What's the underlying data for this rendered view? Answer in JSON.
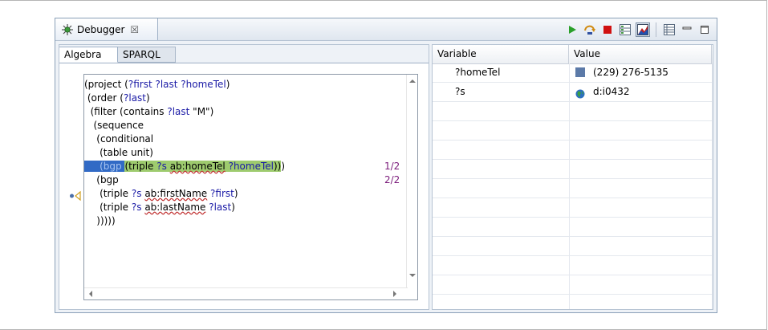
{
  "view": {
    "title": "Debugger",
    "close_glyph": "☒"
  },
  "toolbar": {
    "icons": [
      "resume-icon",
      "step-over-icon",
      "stop-icon",
      "layout-icon",
      "highlight-icon",
      "table-icon",
      "minimize-icon",
      "maximize-icon"
    ],
    "colors": {
      "resume": "#2aa02a",
      "stop": "#d01010",
      "step": "#d08a10"
    }
  },
  "tabs": [
    {
      "label": "Algebra",
      "active": true
    },
    {
      "label": "SPARQL",
      "active": false
    }
  ],
  "code": {
    "lines": [
      {
        "parts": [
          {
            "t": "(project ("
          },
          {
            "t": "?first ?last ?homeTel",
            "c": "var"
          },
          {
            "t": ")"
          }
        ]
      },
      {
        "parts": [
          {
            "t": " (order ("
          },
          {
            "t": "?last",
            "c": "var"
          },
          {
            "t": ")"
          }
        ]
      },
      {
        "parts": [
          {
            "t": "  (filter (contains "
          },
          {
            "t": "?last",
            "c": "var"
          },
          {
            "t": " \"M\")"
          }
        ]
      },
      {
        "parts": [
          {
            "t": "   (sequence"
          }
        ]
      },
      {
        "parts": [
          {
            "t": "    (conditional"
          }
        ]
      },
      {
        "parts": [
          {
            "t": "     (table unit)"
          }
        ]
      },
      {
        "parts": [
          {
            "t": "     (bgp",
            "c": "sel"
          },
          {
            "t": " ",
            "c": "sel"
          },
          {
            "t": "(triple ",
            "c": "match"
          },
          {
            "t": "?s",
            "c": "match var"
          },
          {
            "t": " ",
            "c": "match"
          },
          {
            "t": "ab:homeTel",
            "c": "match prefix"
          },
          {
            "t": " ",
            "c": "match"
          },
          {
            "t": "?homeTel",
            "c": "match var"
          },
          {
            "t": "))",
            "c": "match"
          },
          {
            "t": ")"
          }
        ],
        "ratio": "1/2"
      },
      {
        "parts": [
          {
            "t": "    (bgp"
          }
        ],
        "ratio": "2/2"
      },
      {
        "parts": [
          {
            "t": "     (triple "
          },
          {
            "t": "?s",
            "c": "var"
          },
          {
            "t": " "
          },
          {
            "t": "ab:firstName",
            "c": "prefix"
          },
          {
            "t": " "
          },
          {
            "t": "?first",
            "c": "var"
          },
          {
            "t": ")"
          }
        ]
      },
      {
        "parts": [
          {
            "t": "     (triple "
          },
          {
            "t": "?s",
            "c": "var"
          },
          {
            "t": " "
          },
          {
            "t": "ab:lastName",
            "c": "prefix"
          },
          {
            "t": " "
          },
          {
            "t": "?last",
            "c": "var"
          },
          {
            "t": ")"
          }
        ]
      },
      {
        "parts": [
          {
            "t": "    )))))"
          }
        ]
      }
    ]
  },
  "variables": {
    "headers": {
      "variable": "Variable",
      "value": "Value"
    },
    "rows": [
      {
        "name": "?homeTel",
        "value": "(229) 276-5135",
        "icon": "literal-square-icon"
      },
      {
        "name": "?s",
        "value": "d:i0432",
        "icon": "globe-icon"
      }
    ],
    "empty_rows": 10
  }
}
